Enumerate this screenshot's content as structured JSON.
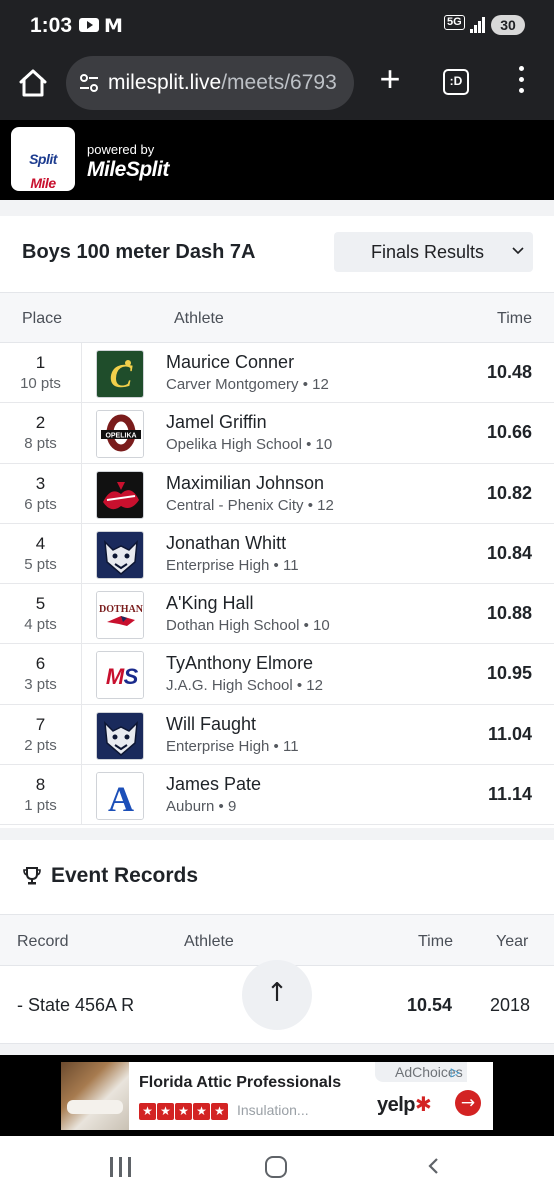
{
  "status_bar": {
    "time": "1:03",
    "network": "5G",
    "battery": "30",
    "gmail_glyph": "M"
  },
  "browser": {
    "url_domain": "milesplit.live",
    "url_path": "/meets/6793",
    "tab_count_glyph": ":D"
  },
  "site_header": {
    "logo_text_a": "Mile",
    "logo_text_b": "Split",
    "powered_by": "powered by",
    "brand": "MileSplit"
  },
  "event": {
    "title": "Boys 100 meter Dash 7A",
    "results_selector": "Finals Results"
  },
  "results": {
    "headers": {
      "place": "Place",
      "athlete": "Athlete",
      "time": "Time"
    },
    "rows": [
      {
        "place": "1",
        "pts": "10 pts",
        "name": "Maurice Conner",
        "school": "Carver Montgomery • 12",
        "time": "10.48",
        "logo": "carver-c-logo"
      },
      {
        "place": "2",
        "pts": "8 pts",
        "name": "Jamel Griffin",
        "school": "Opelika High School • 10",
        "time": "10.66",
        "logo": "opelika-o-logo"
      },
      {
        "place": "3",
        "pts": "6 pts",
        "name": "Maximilian Johnson",
        "school": "Central - Phenix City • 12",
        "time": "10.82",
        "logo": "devils-logo"
      },
      {
        "place": "4",
        "pts": "5 pts",
        "name": "Jonathan Whitt",
        "school": "Enterprise High • 11",
        "time": "10.84",
        "logo": "wildcat-logo"
      },
      {
        "place": "5",
        "pts": "4 pts",
        "name": "A'King Hall",
        "school": "Dothan High School • 10",
        "time": "10.88",
        "logo": "dothan-wolf-logo"
      },
      {
        "place": "6",
        "pts": "3 pts",
        "name": "TyAnthony Elmore",
        "school": "J.A.G. High School • 12",
        "time": "10.95",
        "logo": "ms-logo"
      },
      {
        "place": "7",
        "pts": "2 pts",
        "name": "Will Faught",
        "school": "Enterprise High • 11",
        "time": "11.04",
        "logo": "wildcat-logo"
      },
      {
        "place": "8",
        "pts": "1 pts",
        "name": "James Pate",
        "school": "Auburn • 9",
        "time": "11.14",
        "logo": "auburn-a-logo"
      }
    ]
  },
  "records": {
    "title": "Event Records",
    "headers": {
      "record": "Record",
      "athlete": "Athlete",
      "time": "Time",
      "year": "Year"
    },
    "rows": [
      {
        "record": "- State 456A R",
        "athlete": "",
        "time": "10.54",
        "year": "2018"
      }
    ]
  },
  "ad": {
    "headline": "Florida Attic Professionals",
    "subtext": "Insulation...",
    "adchoices": "AdChoices",
    "brand": "yelp",
    "stars": 5
  },
  "colors": {
    "accent_red": "#c8102e",
    "dark": "#202124",
    "yelp_red": "#d32323"
  }
}
